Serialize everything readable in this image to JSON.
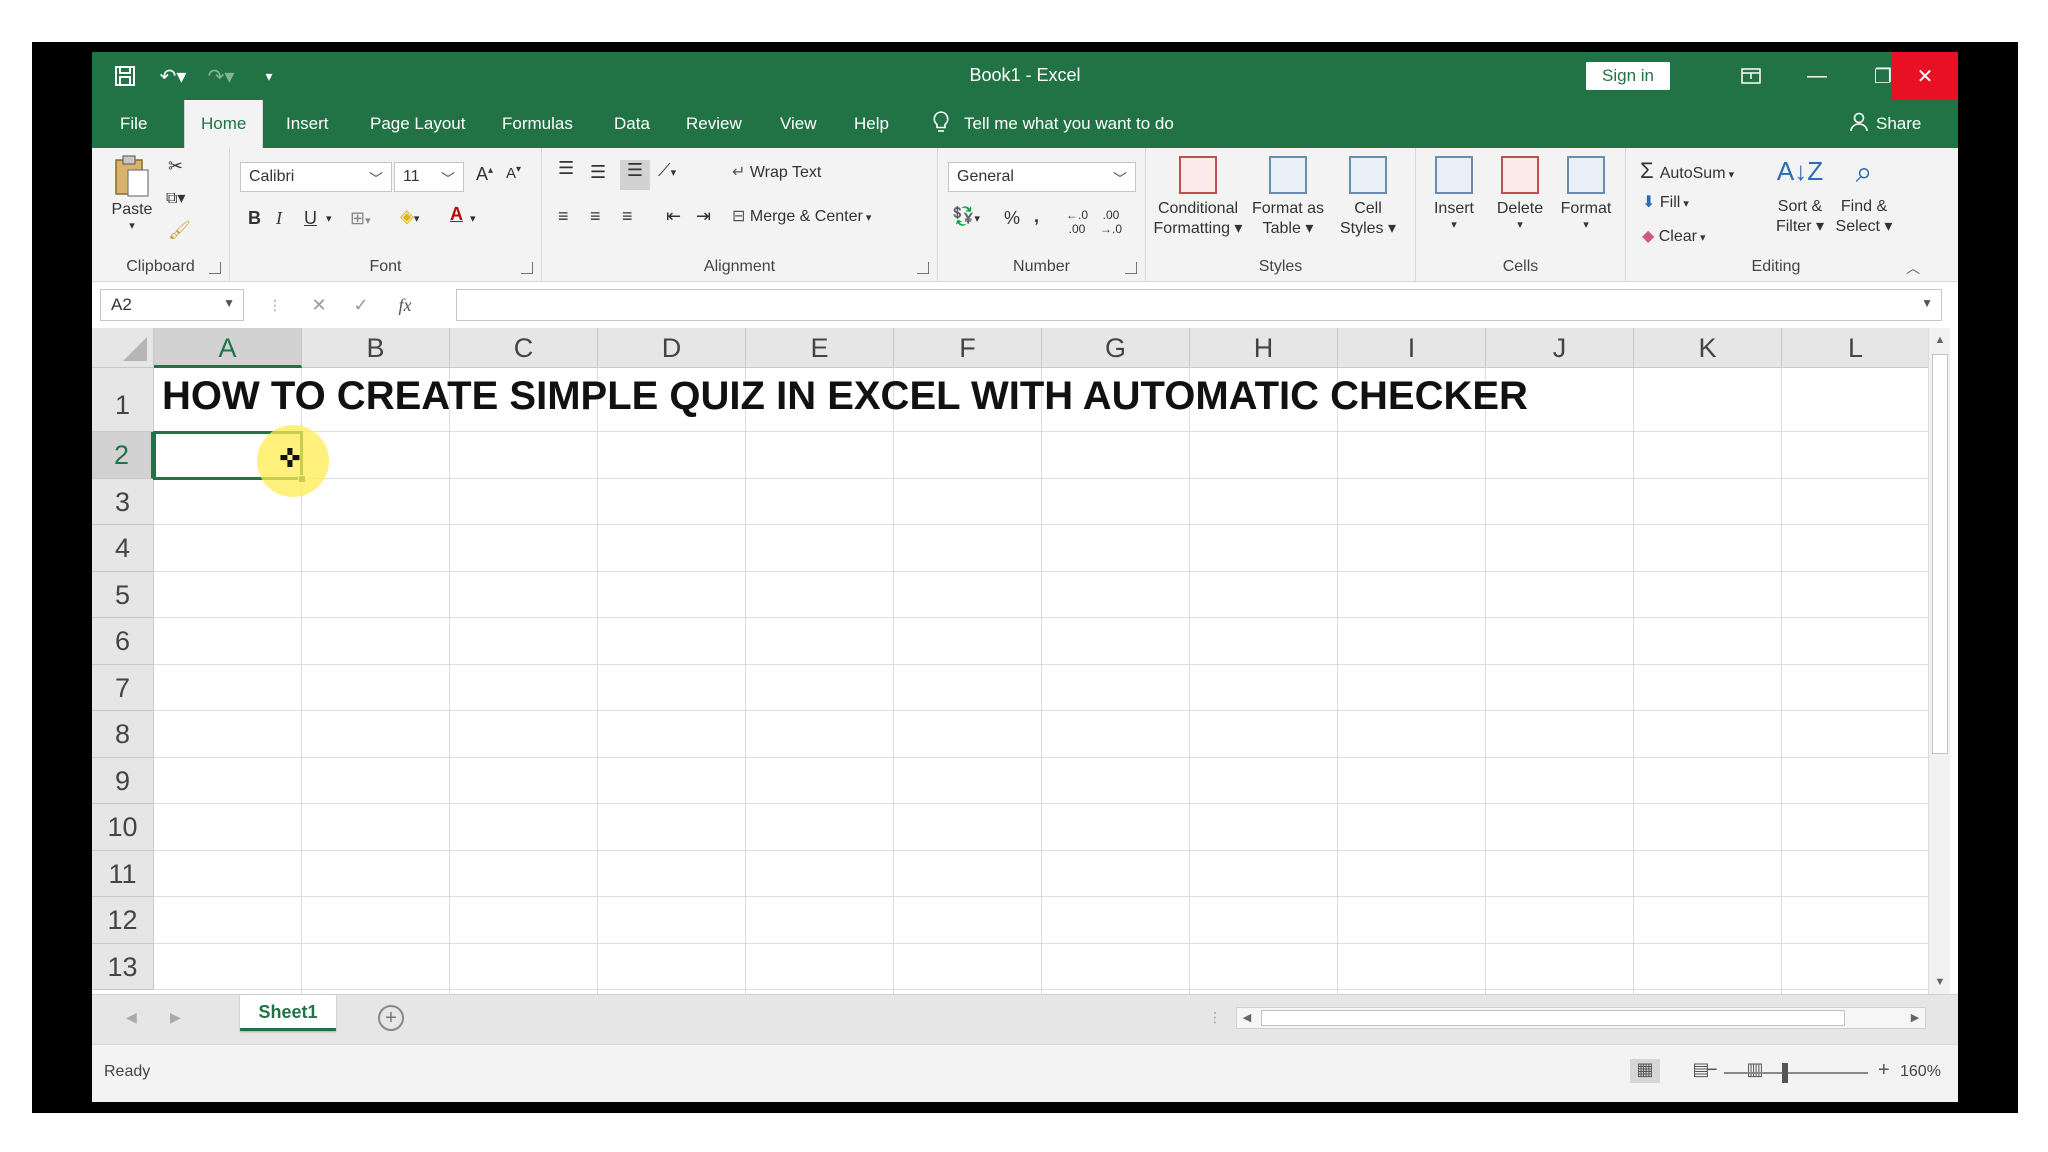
{
  "window": {
    "title": "Book1  -  Excel",
    "sign_in": "Sign in"
  },
  "tabs": [
    {
      "label": "File"
    },
    {
      "label": "Home"
    },
    {
      "label": "Insert"
    },
    {
      "label": "Page Layout"
    },
    {
      "label": "Formulas"
    },
    {
      "label": "Data"
    },
    {
      "label": "Review"
    },
    {
      "label": "View"
    },
    {
      "label": "Help"
    }
  ],
  "tell_me": "Tell me what you want to do",
  "share": "Share",
  "ribbon": {
    "clipboard": {
      "label": "Clipboard",
      "paste": "Paste"
    },
    "font": {
      "label": "Font",
      "name": "Calibri",
      "size": "11"
    },
    "alignment": {
      "label": "Alignment",
      "wrap_text": "Wrap Text",
      "merge_center": "Merge & Center"
    },
    "number": {
      "label": "Number",
      "format": "General"
    },
    "styles": {
      "label": "Styles",
      "conditional_1": "Conditional",
      "conditional_2": "Formatting",
      "format_table_1": "Format as",
      "format_table_2": "Table",
      "cell_styles_1": "Cell",
      "cell_styles_2": "Styles"
    },
    "cells": {
      "label": "Cells",
      "insert": "Insert",
      "delete": "Delete",
      "format": "Format"
    },
    "editing": {
      "label": "Editing",
      "autosum": "AutoSum",
      "fill": "Fill",
      "clear": "Clear",
      "sort_1": "Sort &",
      "sort_2": "Filter",
      "find_1": "Find &",
      "find_2": "Select"
    }
  },
  "formula_bar": {
    "name_box": "A2",
    "fx": "fx",
    "value": ""
  },
  "sheet": {
    "columns": [
      "A",
      "B",
      "C",
      "D",
      "E",
      "F",
      "G",
      "H",
      "I",
      "J",
      "K",
      "L"
    ],
    "rows": [
      "1",
      "2",
      "3",
      "4",
      "5",
      "6",
      "7",
      "8",
      "9",
      "10",
      "11",
      "12",
      "13"
    ],
    "selected_column": "A",
    "selected_row": "2",
    "cell_A1": "HOW TO CREATE SIMPLE QUIZ IN EXCEL WITH AUTOMATIC CHECKER"
  },
  "sheet_tabs": [
    {
      "label": "Sheet1"
    }
  ],
  "status": {
    "text": "Ready",
    "zoom": "160%"
  },
  "colors": {
    "accent": "#217346",
    "close": "#e81123",
    "highlight": "#ffec50"
  }
}
